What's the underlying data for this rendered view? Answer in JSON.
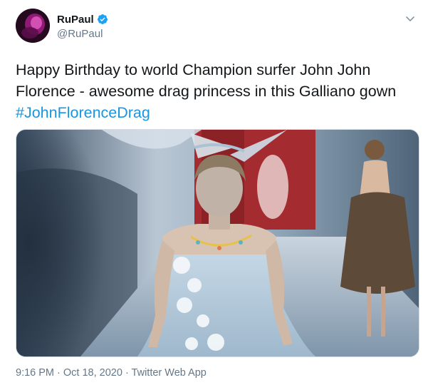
{
  "user": {
    "display_name": "RuPaul",
    "handle": "@RuPaul",
    "verified": true
  },
  "tweet": {
    "text_line1": "Happy Birthday to world Champion surfer John John",
    "text_line2": "Florence - awesome drag princess in this Galliano gown",
    "hashtag": "#JohnFlorenceDrag"
  },
  "meta": {
    "time": "9:16 PM",
    "sep1": " · ",
    "date": "Oct 18, 2020",
    "sep2": " · ",
    "source": "Twitter Web App"
  },
  "colors": {
    "hashtag": "#1b95e0",
    "verified_badge": "#1da1f2",
    "secondary_text": "#657786"
  },
  "icons": {
    "verified": "verified-badge-icon",
    "menu": "chevron-down-icon"
  }
}
